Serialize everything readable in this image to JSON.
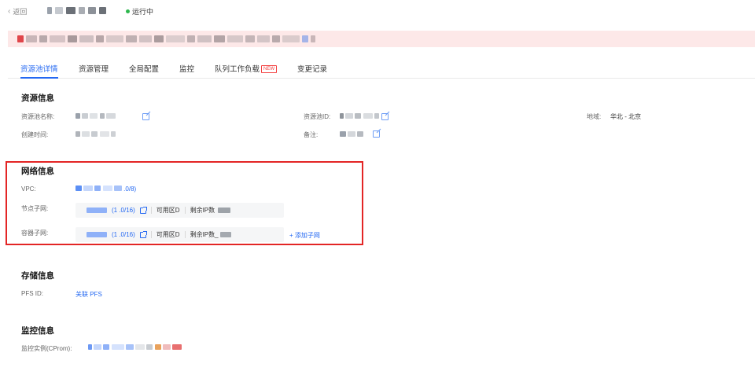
{
  "header": {
    "back_label": "返回",
    "status_text": "运行中",
    "status_color": "#2db74d"
  },
  "tabs": [
    {
      "label": "资源池详情",
      "active": true
    },
    {
      "label": "资源管理"
    },
    {
      "label": "全局配置"
    },
    {
      "label": "监控"
    },
    {
      "label": "队列工作负载",
      "badge": "NEW"
    },
    {
      "label": "变更记录"
    }
  ],
  "resource_info": {
    "title": "资源信息",
    "name_label": "资源池名称:",
    "id_label": "资源池ID:",
    "region_label": "地域:",
    "region_value": "华北 - 北京",
    "created_label": "创建时间:",
    "remark_label": "备注:"
  },
  "network_info": {
    "title": "网络信息",
    "vpc_label": "VPC:",
    "vpc_value_suffix": ".0/8)",
    "node_subnet_label": "节点子网:",
    "node_subnet_cidr": "(1 .0/16)",
    "container_subnet_label": "容器子网:",
    "container_subnet_cidr": "(1 .0/16)",
    "zone_label": "可用区D",
    "remaining_ip_label": "剩余IP数",
    "container_remaining_ip_label": "剩余IP数_",
    "add_subnet_label": "+ 添加子网"
  },
  "storage_info": {
    "title": "存储信息",
    "pfs_label": "PFS ID:",
    "pfs_link": "关联 PFS"
  },
  "monitor_info": {
    "title": "监控信息",
    "cprom_label": "监控实例(CProm):"
  },
  "colors": {
    "accent": "#2468f2",
    "alert_bg": "#fde8e8",
    "highlight_border": "#e32525"
  }
}
